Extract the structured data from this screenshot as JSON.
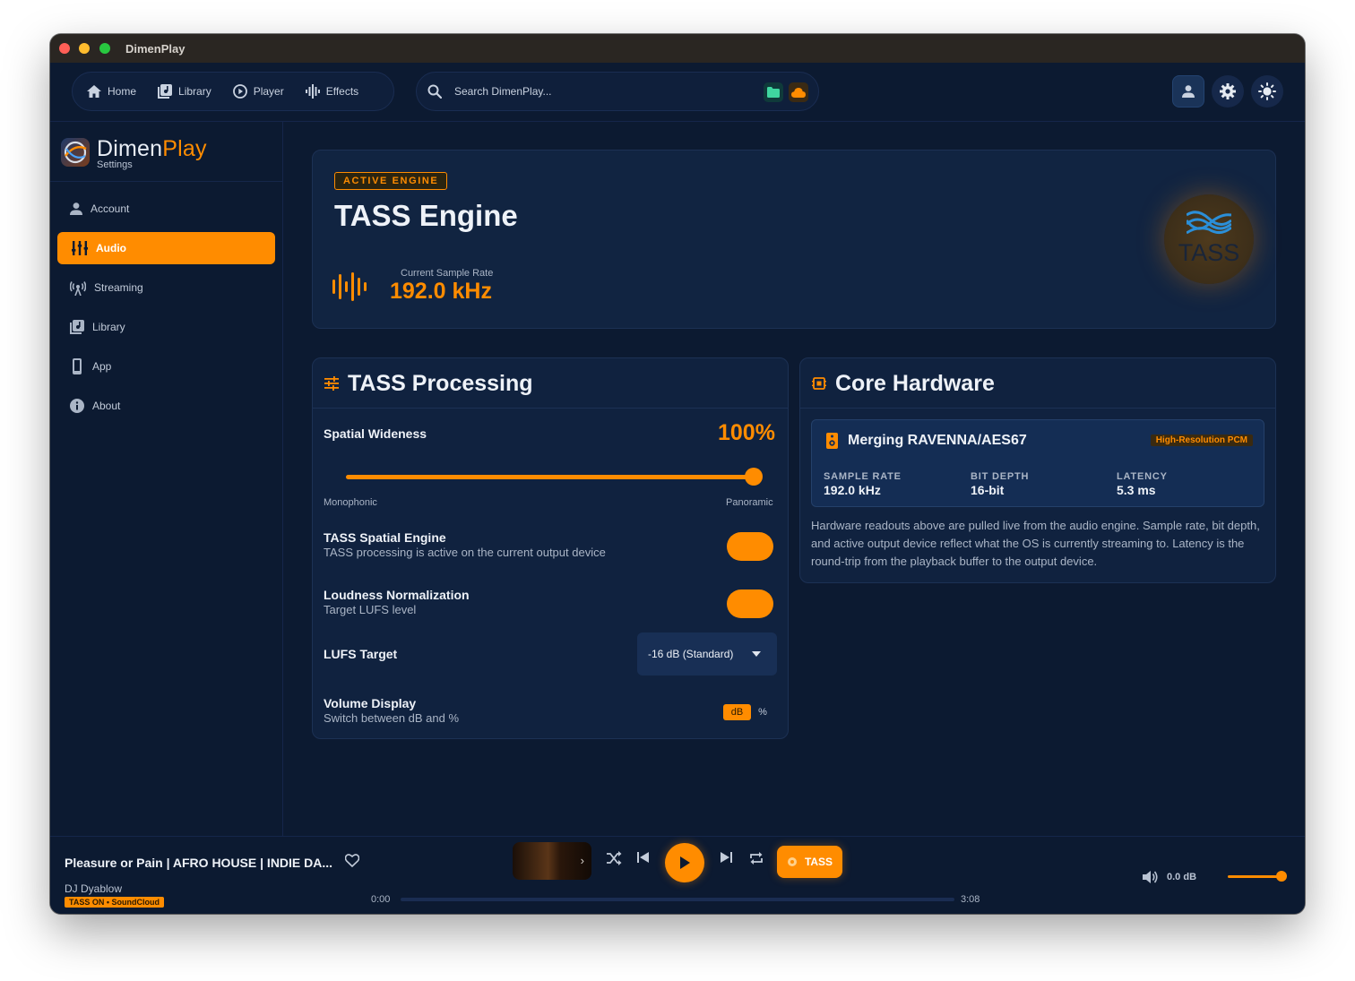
{
  "window": {
    "title": "DimenPlay"
  },
  "nav": {
    "items": [
      {
        "label": "Home",
        "icon": "home-icon"
      },
      {
        "label": "Library",
        "icon": "library-icon"
      },
      {
        "label": "Player",
        "icon": "play-circle-icon"
      },
      {
        "label": "Effects",
        "icon": "waveform-icon"
      }
    ],
    "search_placeholder": "Search DimenPlay..."
  },
  "sidebar": {
    "brand_dimen": "Dimen",
    "brand_play": "Play",
    "brand_sub": "Settings",
    "items": [
      {
        "label": "Account",
        "icon": "person-icon",
        "active": false
      },
      {
        "label": "Audio",
        "icon": "equalizer-icon",
        "active": true
      },
      {
        "label": "Streaming",
        "icon": "antenna-icon",
        "active": false
      },
      {
        "label": "Library",
        "icon": "library-icon",
        "active": false
      },
      {
        "label": "App",
        "icon": "phone-icon",
        "active": false
      },
      {
        "label": "About",
        "icon": "info-icon",
        "active": false
      }
    ]
  },
  "engine": {
    "badge": "ACTIVE ENGINE",
    "title": "TASS Engine",
    "rate_label": "Current Sample Rate",
    "rate_value": "192.0 kHz",
    "logo_text": "TASS"
  },
  "processing": {
    "title": "TASS Processing",
    "spatial_label": "Spatial Wideness",
    "spatial_value": "100%",
    "spatial_level": 1.0,
    "slider_min_label": "Monophonic",
    "slider_max_label": "Panoramic",
    "spatial_engine_label": "TASS Spatial Engine",
    "spatial_engine_sub": "TASS processing is active on the current output device",
    "spatial_engine_on": true,
    "loudness_label": "Loudness Normalization",
    "loudness_sub": "Target LUFS level",
    "loudness_on": true,
    "lufs_label": "LUFS Target",
    "lufs_value": "-16 dB (Standard)",
    "volume_label": "Volume Display",
    "volume_sub": "Switch between dB and %",
    "volume_opt_db": "dB",
    "volume_opt_pct": "%"
  },
  "hardware": {
    "title": "Core Hardware",
    "device_name": "Merging RAVENNA/AES67",
    "device_badge": "High-Resolution PCM",
    "sample_rate_key": "SAMPLE RATE",
    "sample_rate_val": "192.0 kHz",
    "bit_depth_key": "BIT DEPTH",
    "bit_depth_val": "16-bit",
    "latency_key": "LATENCY",
    "latency_val": "5.3 ms",
    "note": "Hardware readouts above are pulled live from the audio engine. Sample rate, bit depth, and active output device reflect what the OS is currently streaming to. Latency is the round-trip from the playback buffer to the output device."
  },
  "player": {
    "title": "Pleasure or Pain | AFRO HOUSE | INDIE DA...",
    "artist": "DJ Dyablow",
    "badge": "TASS ON • SoundCloud",
    "tass_label": "TASS",
    "time_current": "0:00",
    "time_total": "3:08",
    "progress": 0.0,
    "volume_text": "0.0 dB",
    "volume_level": 1.0
  },
  "colors": {
    "accent": "#ff8c00",
    "background": "#0c1a31",
    "card": "#10223f"
  }
}
